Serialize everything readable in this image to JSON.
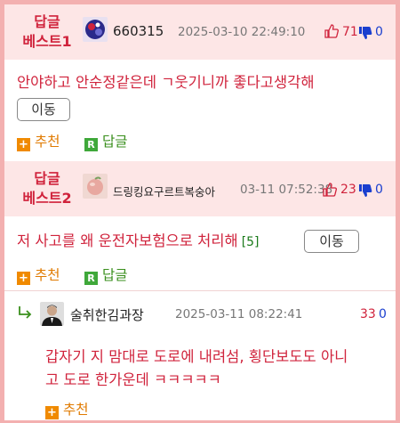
{
  "best1": {
    "label_line1": "답글",
    "label_line2": "베스트1",
    "nickname": "660315",
    "date": "2025-03-10 22:49:10",
    "up": "71",
    "down": "0",
    "text": "안야하고 안순정같은데 ㄱ웃기니까 좋다고생각해",
    "move_label": "이동",
    "recommend_label": "추천",
    "reply_label": "답글"
  },
  "best2": {
    "label_line1": "답글",
    "label_line2": "베스트2",
    "nickname": "드링킹요구르트복숭아",
    "date": "03-11 07:52:38",
    "up": "23",
    "down": "0",
    "text": "저 사고를 왜 운전자보험으로 처리해",
    "reply_count": "[5]",
    "move_label": "이동",
    "recommend_label": "추천",
    "reply_label": "답글"
  },
  "reply": {
    "nickname": "술취한김과장",
    "date": "2025-03-11 08:22:41",
    "up": "33",
    "down": "0",
    "text_line1": "갑자기 지 맘대로 도로에 내려섬, 횡단보도도 아니",
    "text_line2": "고 도로 한가운데 ㅋㅋㅋㅋㅋ",
    "recommend_label": "추천"
  },
  "icons": {
    "thumb_up": "thumb-up-icon",
    "thumb_down": "thumb-down-icon",
    "recommend": "plus-icon",
    "reply": "reply-r-icon",
    "reply_arrow": "reply-arrow-icon"
  },
  "colors": {
    "accent_red": "#d0233c",
    "down_blue": "#1a3fcf",
    "header_bg": "#fde6e6",
    "border_pink": "#f3b0b0",
    "recommend_orange": "#f08a00",
    "reply_green": "#3fa83a"
  }
}
